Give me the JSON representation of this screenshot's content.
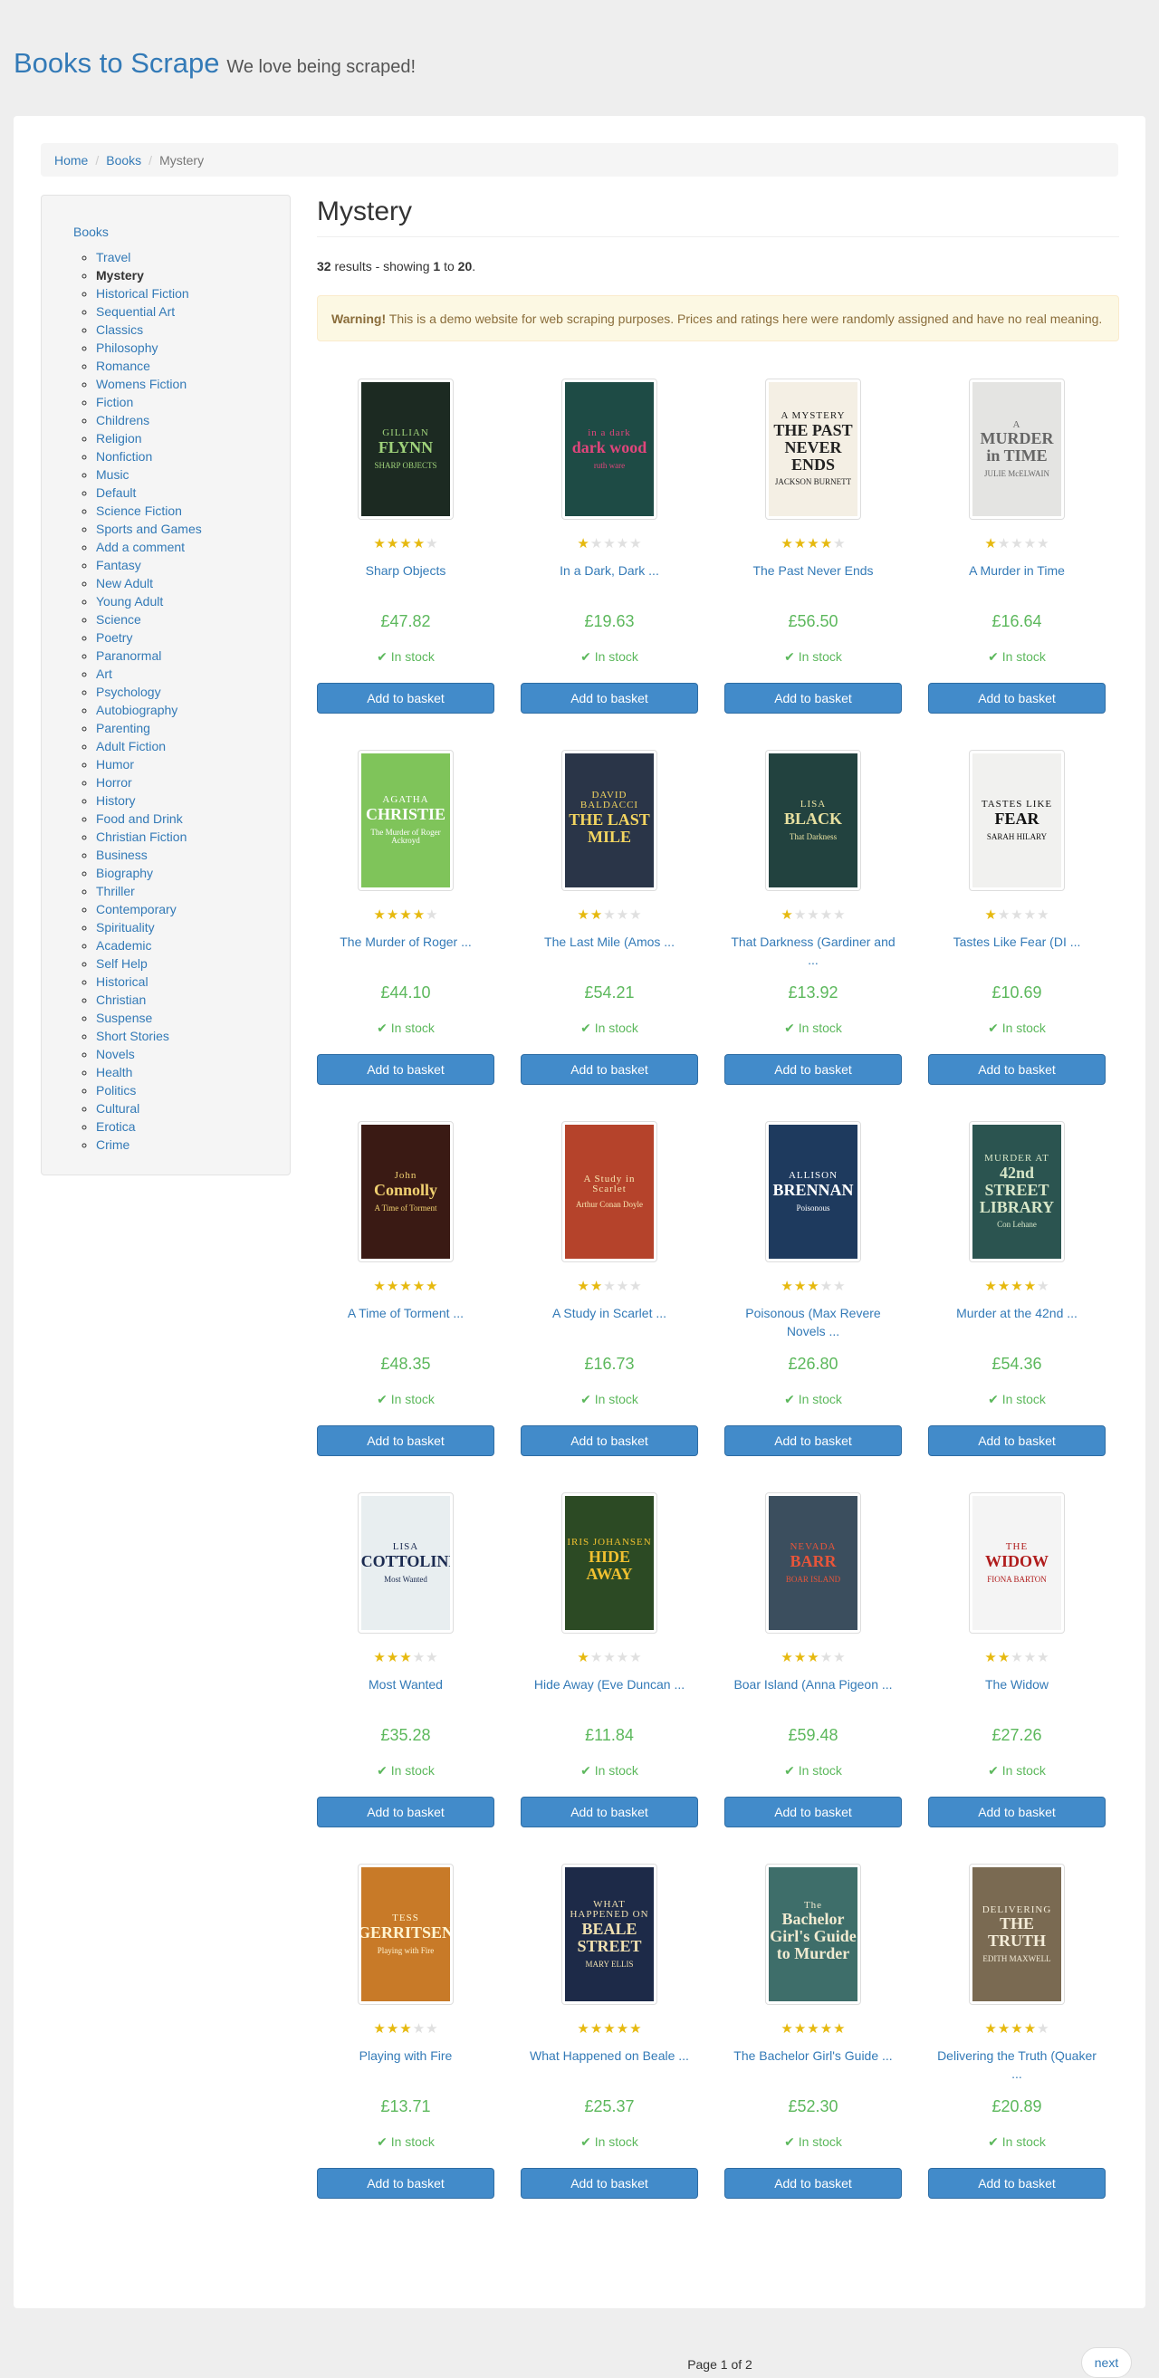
{
  "header": {
    "brand": "Books to Scrape",
    "tagline": "We love being scraped!"
  },
  "breadcrumb": [
    "Home",
    "Books",
    "Mystery"
  ],
  "sidebar": {
    "root": "Books",
    "categories": [
      "Travel",
      "Mystery",
      "Historical Fiction",
      "Sequential Art",
      "Classics",
      "Philosophy",
      "Romance",
      "Womens Fiction",
      "Fiction",
      "Childrens",
      "Religion",
      "Nonfiction",
      "Music",
      "Default",
      "Science Fiction",
      "Sports and Games",
      "Add a comment",
      "Fantasy",
      "New Adult",
      "Young Adult",
      "Science",
      "Poetry",
      "Paranormal",
      "Art",
      "Psychology",
      "Autobiography",
      "Parenting",
      "Adult Fiction",
      "Humor",
      "Horror",
      "History",
      "Food and Drink",
      "Christian Fiction",
      "Business",
      "Biography",
      "Thriller",
      "Contemporary",
      "Spirituality",
      "Academic",
      "Self Help",
      "Historical",
      "Christian",
      "Suspense",
      "Short Stories",
      "Novels",
      "Health",
      "Politics",
      "Cultural",
      "Erotica",
      "Crime"
    ],
    "active": "Mystery"
  },
  "main": {
    "title": "Mystery",
    "results": {
      "count": "32",
      "text1": " results - showing ",
      "from": "1",
      "text2": " to ",
      "to": "20",
      "text3": "."
    },
    "warning": {
      "label": "Warning!",
      "text": " This is a demo website for web scraping purposes. Prices and ratings here were randomly assigned and have no real meaning."
    }
  },
  "products": [
    {
      "title": "Sharp Objects",
      "price": "£47.82",
      "rating": 4,
      "stock": "In stock",
      "button": "Add to basket",
      "cover": {
        "bg": "#1c2a22",
        "fg": "#9fd27a",
        "l1": "GILLIAN",
        "l2": "FLYNN",
        "l3": "SHARP OBJECTS"
      }
    },
    {
      "title": "In a Dark, Dark ...",
      "price": "£19.63",
      "rating": 1,
      "stock": "In stock",
      "button": "Add to basket",
      "cover": {
        "bg": "#1e4b45",
        "fg": "#e0457b",
        "l1": "in a dark",
        "l2": "dark wood",
        "l3": "ruth ware"
      }
    },
    {
      "title": "The Past Never Ends",
      "price": "£56.50",
      "rating": 4,
      "stock": "In stock",
      "button": "Add to basket",
      "cover": {
        "bg": "#f4efe4",
        "fg": "#222222",
        "l1": "A MYSTERY",
        "l2": "THE PAST NEVER ENDS",
        "l3": "JACKSON BURNETT"
      }
    },
    {
      "title": "A Murder in Time",
      "price": "£16.64",
      "rating": 1,
      "stock": "In stock",
      "button": "Add to basket",
      "cover": {
        "bg": "#e4e4e2",
        "fg": "#666666",
        "l1": "A",
        "l2": "MURDER in TIME",
        "l3": "JULIE McELWAIN"
      }
    },
    {
      "title": "The Murder of Roger ...",
      "price": "£44.10",
      "rating": 4,
      "stock": "In stock",
      "button": "Add to basket",
      "cover": {
        "bg": "#7fc45a",
        "fg": "#ffffff",
        "l1": "AGATHA",
        "l2": "CHRISTIE",
        "l3": "The Murder of Roger Ackroyd"
      }
    },
    {
      "title": "The Last Mile (Amos ...",
      "price": "£54.21",
      "rating": 2,
      "stock": "In stock",
      "button": "Add to basket",
      "cover": {
        "bg": "#2a3548",
        "fg": "#f3d560",
        "l1": "DAVID BALDACCI",
        "l2": "THE LAST MILE",
        "l3": ""
      }
    },
    {
      "title": "That Darkness (Gardiner and ...",
      "price": "£13.92",
      "rating": 1,
      "stock": "In stock",
      "button": "Add to basket",
      "cover": {
        "bg": "#22423f",
        "fg": "#e8e0a0",
        "l1": "LISA",
        "l2": "BLACK",
        "l3": "That Darkness"
      }
    },
    {
      "title": "Tastes Like Fear (DI ...",
      "price": "£10.69",
      "rating": 1,
      "stock": "In stock",
      "button": "Add to basket",
      "cover": {
        "bg": "#f1f1ef",
        "fg": "#111111",
        "l1": "TASTES LIKE",
        "l2": "FEAR",
        "l3": "SARAH HILARY"
      }
    },
    {
      "title": "A Time of Torment ...",
      "price": "£48.35",
      "rating": 5,
      "stock": "In stock",
      "button": "Add to basket",
      "cover": {
        "bg": "#3a1a14",
        "fg": "#f0d070",
        "l1": "John",
        "l2": "Connolly",
        "l3": "A Time of Torment"
      }
    },
    {
      "title": "A Study in Scarlet ...",
      "price": "£16.73",
      "rating": 2,
      "stock": "In stock",
      "button": "Add to basket",
      "cover": {
        "bg": "#b5432b",
        "fg": "#f8e6b0",
        "l1": "A Study in Scarlet",
        "l2": "",
        "l3": "Arthur Conan Doyle"
      }
    },
    {
      "title": "Poisonous (Max Revere Novels ...",
      "price": "£26.80",
      "rating": 3,
      "stock": "In stock",
      "button": "Add to basket",
      "cover": {
        "bg": "#1e3a5e",
        "fg": "#ffffff",
        "l1": "ALLISON",
        "l2": "BRENNAN",
        "l3": "Poisonous"
      }
    },
    {
      "title": "Murder at the 42nd ...",
      "price": "£54.36",
      "rating": 4,
      "stock": "In stock",
      "button": "Add to basket",
      "cover": {
        "bg": "#2b5450",
        "fg": "#d7e6c8",
        "l1": "MURDER AT",
        "l2": "42nd STREET LIBRARY",
        "l3": "Con Lehane"
      }
    },
    {
      "title": "Most Wanted",
      "price": "£35.28",
      "rating": 3,
      "stock": "In stock",
      "button": "Add to basket",
      "cover": {
        "bg": "#e8eef0",
        "fg": "#1a2a50",
        "l1": "LISA",
        "l2": "SCOTTOLINE",
        "l3": "Most Wanted"
      }
    },
    {
      "title": "Hide Away (Eve Duncan ...",
      "price": "£11.84",
      "rating": 1,
      "stock": "In stock",
      "button": "Add to basket",
      "cover": {
        "bg": "#2c4a24",
        "fg": "#f0c030",
        "l1": "IRIS JOHANSEN",
        "l2": "HIDE AWAY",
        "l3": ""
      }
    },
    {
      "title": "Boar Island (Anna Pigeon ...",
      "price": "£59.48",
      "rating": 3,
      "stock": "In stock",
      "button": "Add to basket",
      "cover": {
        "bg": "#3b4e5e",
        "fg": "#e8553a",
        "l1": "NEVADA",
        "l2": "BARR",
        "l3": "BOAR ISLAND"
      }
    },
    {
      "title": "The Widow",
      "price": "£27.26",
      "rating": 2,
      "stock": "In stock",
      "button": "Add to basket",
      "cover": {
        "bg": "#f4f4f4",
        "fg": "#b01c1c",
        "l1": "THE",
        "l2": "WIDOW",
        "l3": "FIONA BARTON"
      }
    },
    {
      "title": "Playing with Fire",
      "price": "£13.71",
      "rating": 3,
      "stock": "In stock",
      "button": "Add to basket",
      "cover": {
        "bg": "#c87a28",
        "fg": "#fff4d0",
        "l1": "TESS",
        "l2": "GERRITSEN",
        "l3": "Playing with Fire"
      }
    },
    {
      "title": "What Happened on Beale ...",
      "price": "£25.37",
      "rating": 5,
      "stock": "In stock",
      "button": "Add to basket",
      "cover": {
        "bg": "#1d2a48",
        "fg": "#f0e0b0",
        "l1": "WHAT HAPPENED ON",
        "l2": "BEALE STREET",
        "l3": "MARY ELLIS"
      }
    },
    {
      "title": "The Bachelor Girl's Guide ...",
      "price": "£52.30",
      "rating": 5,
      "stock": "In stock",
      "button": "Add to basket",
      "cover": {
        "bg": "#3e6e6a",
        "fg": "#f0ead0",
        "l1": "The",
        "l2": "Bachelor Girl's Guide to Murder",
        "l3": ""
      }
    },
    {
      "title": "Delivering the Truth (Quaker ...",
      "price": "£20.89",
      "rating": 4,
      "stock": "In stock",
      "button": "Add to basket",
      "cover": {
        "bg": "#7a6a52",
        "fg": "#f4ecd8",
        "l1": "DELIVERING",
        "l2": "THE TRUTH",
        "l3": "EDITH MAXWELL"
      }
    }
  ],
  "pager": {
    "current": "Page 1 of 2",
    "next": "next"
  }
}
